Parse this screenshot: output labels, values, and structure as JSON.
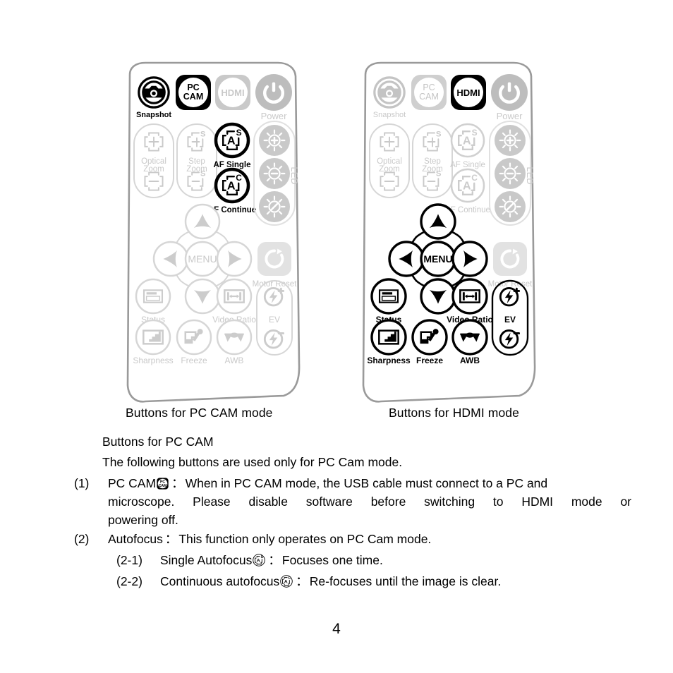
{
  "document": {
    "page_number": "4",
    "captions": {
      "left": "Buttons for PC CAM mode",
      "right": "Buttons for HDMI mode"
    },
    "heading": "Buttons for PC CAM",
    "intro": "The following buttons are used only for PC Cam mode.",
    "items": [
      {
        "number": "(1)",
        "label": "PC CAM",
        "icon": "pc-cam-icon",
        "colon": "：",
        "text_line1": "When in PC CAM mode, the USB cable must connect to a PC and",
        "text_line2": "microscope. Please disable software before switching to HDMI mode or",
        "text_line3": "powering off."
      },
      {
        "number": "(2)",
        "label": "Autofocus",
        "colon": "：",
        "text": "This function only operates on PC Cam mode."
      }
    ],
    "subitems": [
      {
        "number": "(2-1)",
        "label": "Single Autofocus",
        "icon": "af-single-icon",
        "colon": "：",
        "text": "Focuses one time."
      },
      {
        "number": "(2-2)",
        "label": "Continuous autofocus",
        "icon": "af-continue-icon",
        "colon": "：",
        "text": "Re-focuses until the image is clear."
      }
    ]
  },
  "colors": {
    "active": "#000000",
    "inactive": "#c9c9c9",
    "inactive_fill": "#bdbdbd",
    "body_outline": "#9a9a9a",
    "page_bg": "#ffffff"
  },
  "remotes": [
    {
      "id": "pc-cam-remote",
      "mode": "PC CAM",
      "active_buttons": [
        "Snapshot",
        "PC CAM",
        "AF Single",
        "AF Continue"
      ],
      "buttons": [
        {
          "name": "Snapshot",
          "label": "Snapshot",
          "icon": "camera-icon",
          "state": "active"
        },
        {
          "name": "PC CAM",
          "label": "",
          "icon": "pc-cam-icon",
          "state": "active",
          "face_text": "PC\nCAM"
        },
        {
          "name": "HDMI",
          "label": "",
          "icon": "hdmi-icon",
          "state": "inactive",
          "face_text": "HDMI"
        },
        {
          "name": "Power",
          "label": "Power",
          "icon": "power-icon",
          "state": "inactive"
        },
        {
          "name": "Optical Zoom",
          "label": "Optical Zoom",
          "icon": "zoom-crosshair-icon",
          "state": "inactive"
        },
        {
          "name": "Step Zoom",
          "label": "Step Zoom",
          "icon": "step-zoom-icon",
          "state": "inactive"
        },
        {
          "name": "AF Single",
          "label": "AF Single",
          "icon": "af-single-icon",
          "state": "active"
        },
        {
          "name": "AF Continue",
          "label": "AF Continue",
          "icon": "af-continue-icon",
          "state": "active"
        },
        {
          "name": "LED",
          "label": "LED",
          "icon": "led-icon",
          "state": "inactive"
        },
        {
          "name": "Up",
          "label": "",
          "icon": "arrow-up-icon",
          "state": "inactive"
        },
        {
          "name": "Left",
          "label": "",
          "icon": "arrow-left-icon",
          "state": "inactive"
        },
        {
          "name": "MENU",
          "label": "",
          "icon": "menu-icon",
          "state": "inactive",
          "face_text": "MENU"
        },
        {
          "name": "Right",
          "label": "",
          "icon": "arrow-right-icon",
          "state": "inactive"
        },
        {
          "name": "Down",
          "label": "",
          "icon": "arrow-down-icon",
          "state": "inactive"
        },
        {
          "name": "Motor Reset",
          "label": "Motor Reset",
          "icon": "refresh-icon",
          "state": "inactive"
        },
        {
          "name": "Status",
          "label": "Status",
          "icon": "status-icon",
          "state": "inactive"
        },
        {
          "name": "Video Ratio",
          "label": "Video Ratio",
          "icon": "video-ratio-icon",
          "state": "inactive"
        },
        {
          "name": "EV",
          "label": "EV",
          "icon": "ev-icon",
          "state": "inactive"
        },
        {
          "name": "Sharpness",
          "label": "Sharpness",
          "icon": "sharpness-icon",
          "state": "inactive"
        },
        {
          "name": "Freeze",
          "label": "Freeze",
          "icon": "freeze-icon",
          "state": "inactive"
        },
        {
          "name": "AWB",
          "label": "AWB",
          "icon": "awb-icon",
          "state": "inactive"
        }
      ]
    },
    {
      "id": "hdmi-remote",
      "mode": "HDMI",
      "active_buttons": [
        "HDMI",
        "Up",
        "Left",
        "MENU",
        "Right",
        "Down",
        "Status",
        "Video Ratio",
        "EV",
        "Sharpness",
        "Freeze",
        "AWB"
      ],
      "buttons": [
        {
          "name": "Snapshot",
          "label": "Snapshot",
          "icon": "camera-icon",
          "state": "inactive"
        },
        {
          "name": "PC CAM",
          "label": "",
          "icon": "pc-cam-icon",
          "state": "inactive",
          "face_text": "PC\nCAM"
        },
        {
          "name": "HDMI",
          "label": "",
          "icon": "hdmi-icon",
          "state": "active",
          "face_text": "HDMI"
        },
        {
          "name": "Power",
          "label": "Power",
          "icon": "power-icon",
          "state": "inactive"
        },
        {
          "name": "Optical Zoom",
          "label": "Optical Zoom",
          "icon": "zoom-crosshair-icon",
          "state": "inactive"
        },
        {
          "name": "Step Zoom",
          "label": "Step Zoom",
          "icon": "step-zoom-icon",
          "state": "inactive"
        },
        {
          "name": "AF Single",
          "label": "AF Single",
          "icon": "af-single-icon",
          "state": "inactive"
        },
        {
          "name": "AF Continue",
          "label": "AF Continue",
          "icon": "af-continue-icon",
          "state": "inactive"
        },
        {
          "name": "LED",
          "label": "LED",
          "icon": "led-icon",
          "state": "inactive"
        },
        {
          "name": "Up",
          "label": "",
          "icon": "arrow-up-icon",
          "state": "active"
        },
        {
          "name": "Left",
          "label": "",
          "icon": "arrow-left-icon",
          "state": "active"
        },
        {
          "name": "MENU",
          "label": "",
          "icon": "menu-icon",
          "state": "active",
          "face_text": "MENU"
        },
        {
          "name": "Right",
          "label": "",
          "icon": "arrow-right-icon",
          "state": "active"
        },
        {
          "name": "Down",
          "label": "",
          "icon": "arrow-down-icon",
          "state": "active"
        },
        {
          "name": "Motor Reset",
          "label": "Motor Reset",
          "icon": "refresh-icon",
          "state": "inactive"
        },
        {
          "name": "Status",
          "label": "Status",
          "icon": "status-icon",
          "state": "active"
        },
        {
          "name": "Video Ratio",
          "label": "Video Ratio",
          "icon": "video-ratio-icon",
          "state": "active"
        },
        {
          "name": "EV",
          "label": "EV",
          "icon": "ev-icon",
          "state": "active"
        },
        {
          "name": "Sharpness",
          "label": "Sharpness",
          "icon": "sharpness-icon",
          "state": "active"
        },
        {
          "name": "Freeze",
          "label": "Freeze",
          "icon": "freeze-icon",
          "state": "active"
        },
        {
          "name": "AWB",
          "label": "AWB",
          "icon": "awb-icon",
          "state": "active"
        }
      ]
    }
  ],
  "button_labels": {
    "snapshot": "Snapshot",
    "power": "Power",
    "optical_zoom_l1": "Optical",
    "optical_zoom_l2": "Zoom",
    "step_zoom_l1": "Step",
    "step_zoom_l2": "Zoom",
    "af_single": "AF Single",
    "af_continue": "AF Continue",
    "led": "LED",
    "menu": "MENU",
    "motor_reset": "Motor Reset",
    "status": "Status",
    "video_ratio": "Video Ratio",
    "ev": "EV",
    "sharpness": "Sharpness",
    "freeze": "Freeze",
    "awb": "AWB",
    "pc_cam_l1": "PC",
    "pc_cam_l2": "CAM",
    "hdmi": "HDMI",
    "af_letter": "A",
    "af_single_letter": "S",
    "af_continue_letter": "C",
    "step_letter": "S"
  }
}
